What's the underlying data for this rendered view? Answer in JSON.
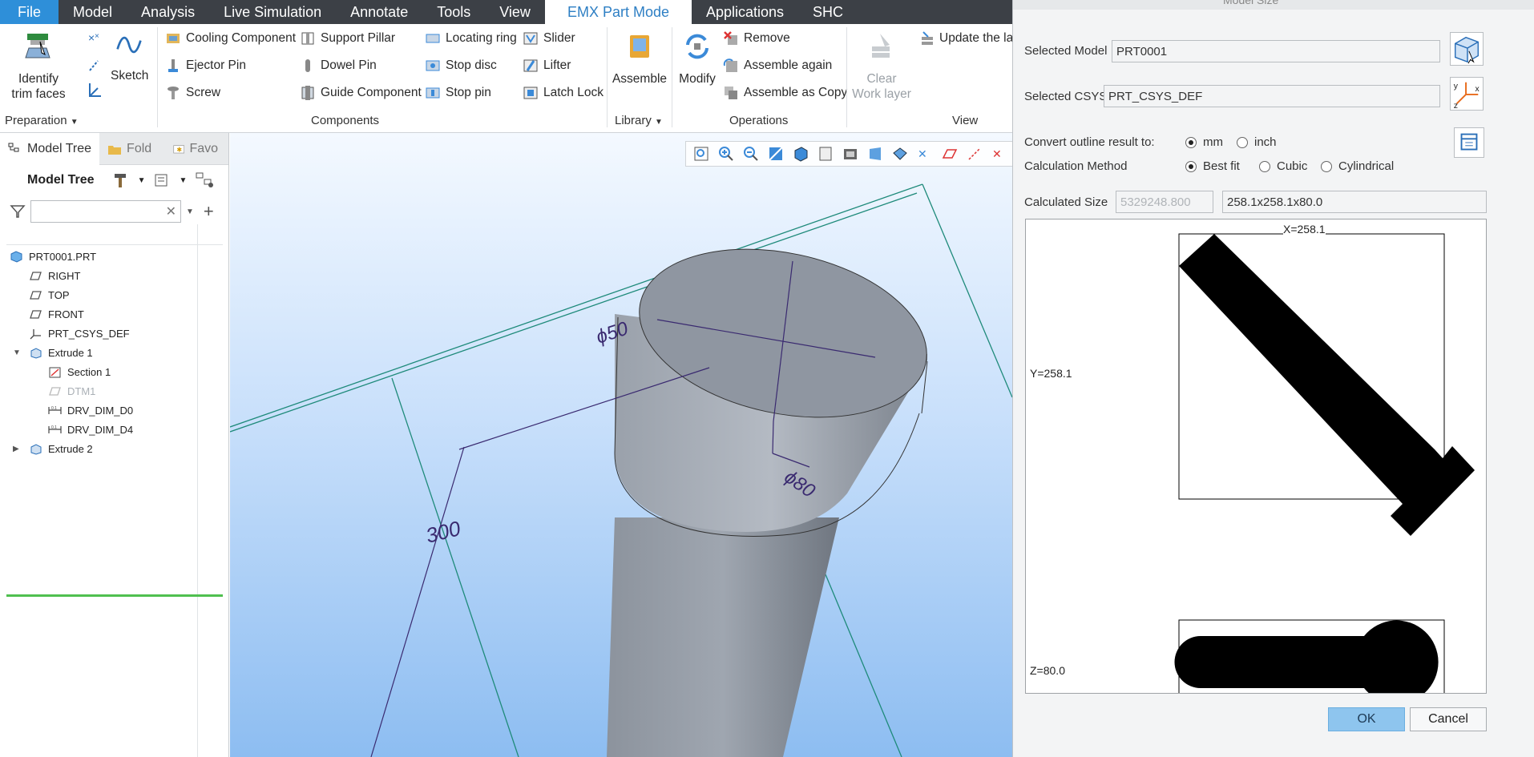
{
  "menubar": {
    "items": [
      "File",
      "Model",
      "Analysis",
      "Live Simulation",
      "Annotate",
      "Tools",
      "View",
      "EMX Part Mode",
      "Applications",
      "SHC"
    ],
    "active": "EMX Part Mode",
    "right_icons": [
      "minimize-icon",
      "help-icon"
    ]
  },
  "ribbon": {
    "preparation": {
      "identify_label": "Identify\ntrim faces",
      "sketch_label": "Sketch",
      "group_label": "Preparation"
    },
    "components": {
      "cooling": "Cooling Component",
      "ejector": "Ejector Pin",
      "screw": "Screw",
      "support": "Support Pillar",
      "dowel": "Dowel Pin",
      "guide": "Guide Component",
      "locating": "Locating ring",
      "stopdisc": "Stop disc",
      "stoppin": "Stop pin",
      "slider": "Slider",
      "lifter": "Lifter",
      "latch": "Latch Lock",
      "group_label": "Components"
    },
    "library": {
      "assemble_label": "Assemble",
      "group_label": "Library"
    },
    "operations": {
      "modify": "Modify",
      "remove": "Remove",
      "assemble_again": "Assemble again",
      "assemble_copy": "Assemble as Copy",
      "group_label": "Operations"
    },
    "view": {
      "clear_label": "Clear\nWork layer",
      "update_label": "Update the lay",
      "group_label": "View"
    }
  },
  "leftpanel": {
    "tabs": [
      "Model Tree",
      "Fold",
      "Favo"
    ],
    "toolbar_title": "Model Tree",
    "filter_placeholder": "",
    "tree": [
      {
        "label": "PRT0001.PRT",
        "level": 0,
        "icon": "part-icon"
      },
      {
        "label": "RIGHT",
        "level": 1,
        "icon": "datum-plane-icon"
      },
      {
        "label": "TOP",
        "level": 1,
        "icon": "datum-plane-icon"
      },
      {
        "label": "FRONT",
        "level": 1,
        "icon": "datum-plane-icon"
      },
      {
        "label": "PRT_CSYS_DEF",
        "level": 1,
        "icon": "csys-icon"
      },
      {
        "label": "Extrude 1",
        "level": 1,
        "icon": "extrude-icon",
        "expanded": true
      },
      {
        "label": "Section 1",
        "level": 2,
        "icon": "sketch-icon"
      },
      {
        "label": "DTM1",
        "level": 2,
        "icon": "datum-plane-icon",
        "dimmed": true
      },
      {
        "label": "DRV_DIM_D0",
        "level": 2,
        "icon": "dimension-icon"
      },
      {
        "label": "DRV_DIM_D4",
        "level": 2,
        "icon": "dimension-icon"
      },
      {
        "label": "Extrude 2",
        "level": 1,
        "icon": "extrude-icon",
        "expanded": false
      }
    ]
  },
  "viewport": {
    "dimensions": [
      "ϕ50",
      "ϕ80",
      "300"
    ]
  },
  "dialog": {
    "title": "Model Size",
    "selected_model_label": "Selected Model",
    "selected_model_value": "PRT0001",
    "selected_csys_label": "Selected CSYS",
    "selected_csys_value": "PRT_CSYS_DEF",
    "convert_label": "Convert outline result to:",
    "unit_options": [
      "mm",
      "inch"
    ],
    "unit_selected": "mm",
    "method_label": "Calculation Method",
    "method_options": [
      "Best fit",
      "Cubic",
      "Cylindrical"
    ],
    "method_selected": "Best fit",
    "calc_size_label": "Calculated Size",
    "calc_volume": "5329248.800",
    "calc_dims": "258.1x258.1x80.0",
    "x_label": "X=258.1",
    "y_label": "Y=258.1",
    "z_label": "Z=80.0",
    "ok_label": "OK",
    "cancel_label": "Cancel"
  }
}
